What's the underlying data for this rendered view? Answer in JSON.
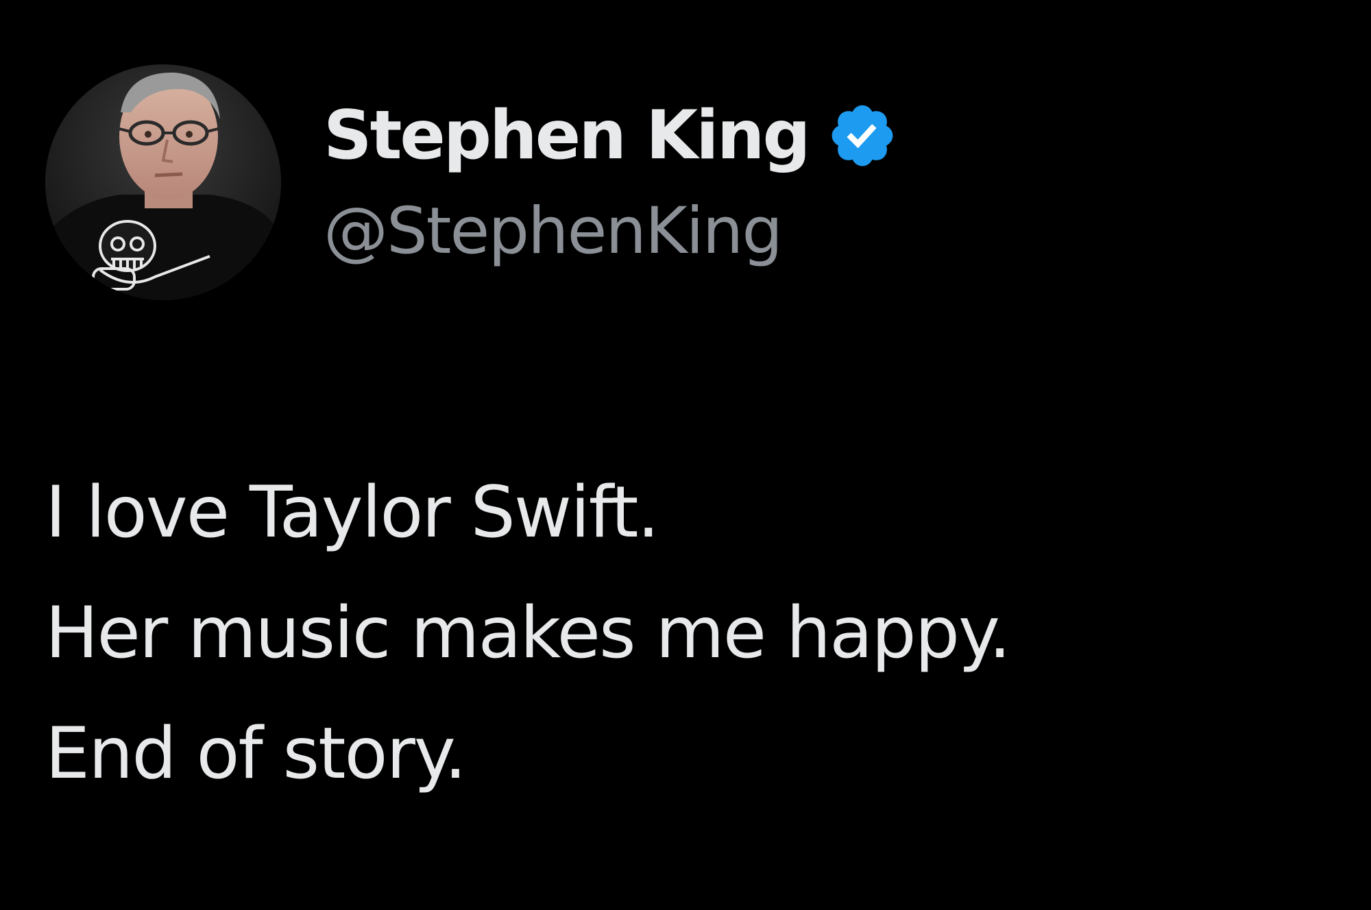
{
  "author": {
    "display_name": "Stephen King",
    "handle": "@StephenKing",
    "verified": true,
    "avatar_icon": "profile-photo",
    "verified_icon": "verified-badge-icon",
    "verified_color": "#1d9bf0"
  },
  "tweet": {
    "lines": [
      "I love Taylor Swift.",
      "Her music makes me happy.",
      "End of story."
    ]
  },
  "colors": {
    "background": "#000000",
    "primary_text": "#e7e9ea",
    "secondary_text": "#8b9096"
  }
}
